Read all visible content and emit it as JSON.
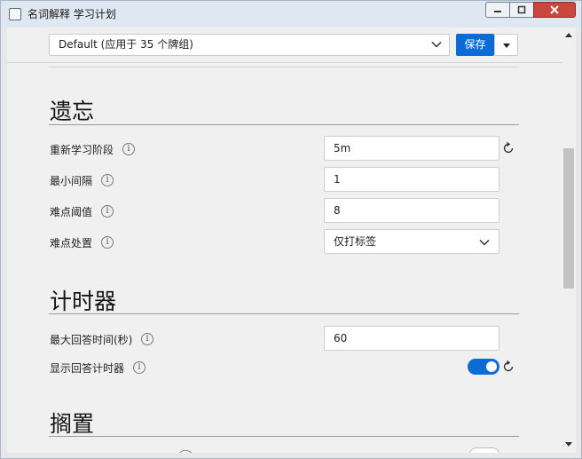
{
  "window": {
    "title": "名词解释 学习计划"
  },
  "preset": {
    "value": "Default (应用于 35 个牌组)",
    "save_label": "保存"
  },
  "sections": {
    "lapses": {
      "title": "遗忘",
      "relearning_steps": {
        "label": "重新学习阶段",
        "value": "5m"
      },
      "minimum_interval": {
        "label": "最小间隔",
        "value": "1"
      },
      "leech_threshold": {
        "label": "难点阈值",
        "value": "8"
      },
      "leech_action": {
        "label": "难点处置",
        "value": "仅打标签"
      }
    },
    "timer": {
      "title": "计时器",
      "max_answer_seconds": {
        "label": "最大回答时间(秒)",
        "value": "60"
      },
      "show_timer": {
        "label": "显示回答计时器",
        "enabled": true
      }
    },
    "burying": {
      "title": "搁置"
    }
  },
  "icons": {
    "info": "info-icon",
    "reset": "reset-icon"
  },
  "colors": {
    "accent": "#0b6cd5",
    "close": "#c9473c"
  },
  "info_glyph": "i"
}
